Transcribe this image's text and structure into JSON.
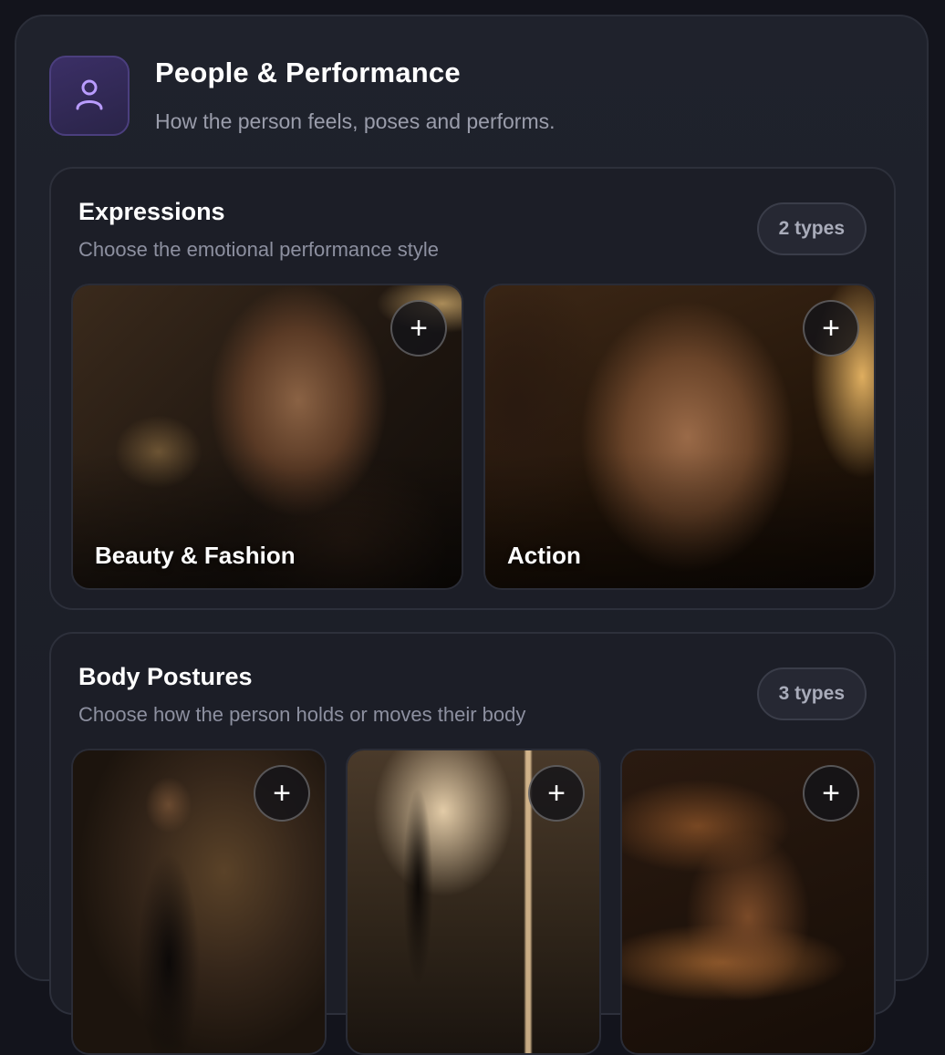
{
  "header": {
    "icon": "person-icon",
    "title": "People & Performance",
    "subtitle": "How the person feels, poses and performs."
  },
  "sections": [
    {
      "title": "Expressions",
      "subtitle": "Choose the emotional performance style",
      "badge": "2 types",
      "cards": [
        {
          "label": "Beauty & Fashion",
          "image": "glamorous woman portrait, warm bokeh"
        },
        {
          "label": "Action",
          "image": "intense close-up face, sweat and sparks"
        }
      ]
    },
    {
      "title": "Body Postures",
      "subtitle": "Choose how the person holds or moves their body",
      "badge": "3 types",
      "cards": [
        {
          "label": "",
          "image": "woman standing in black dress"
        },
        {
          "label": "",
          "image": "yoga pose silhouette, backlit"
        },
        {
          "label": "",
          "image": "sprinting woman with fiery light streaks"
        }
      ]
    }
  ],
  "colors": {
    "accent": "#8b6cf0",
    "panel": "#1f222c",
    "section": "#1c1e27"
  },
  "icons": {
    "add": "plus-icon"
  }
}
